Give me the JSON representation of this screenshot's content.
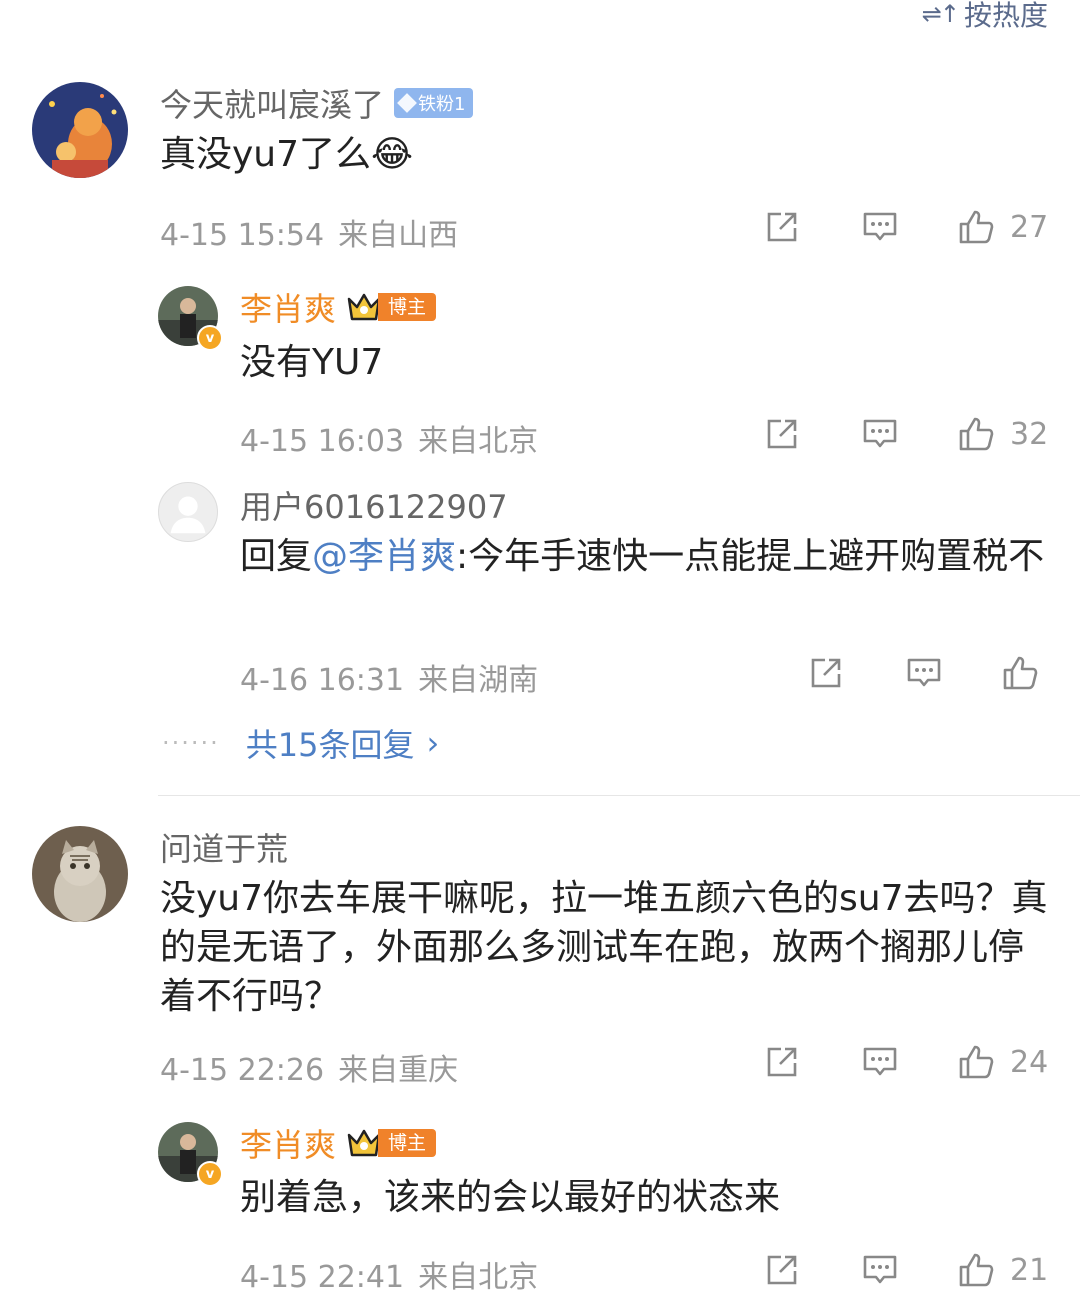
{
  "sort": {
    "icon": "sort-icon",
    "label": "按热度"
  },
  "comments": [
    {
      "user": "今天就叫宸溪了",
      "badge": "铁粉1",
      "text": "真没yu7了么",
      "emoji": "😂",
      "date": "4-15 15:54",
      "location": "来自山西",
      "likes": "27",
      "replies": [
        {
          "user": "李肖爽",
          "badge": "博主",
          "text": "没有YU7",
          "date": "4-15 16:03",
          "location": "来自北京",
          "likes": "32"
        },
        {
          "user": "用户6016122907",
          "text_prefix": "回复",
          "mention": "@李肖爽",
          "text_rest": ":今年手速快一点能提上避开购置税不",
          "date": "4-16 16:31",
          "location": "来自湖南",
          "likes": ""
        }
      ],
      "more_replies": "共15条回复"
    },
    {
      "user": "问道于荒",
      "text": "没yu7你去车展干嘛呢，拉一堆五颜六色的su7去吗？真的是无语了，外面那么多测试车在跑，放两个搁那儿停着不行吗？",
      "date": "4-15 22:26",
      "location": "来自重庆",
      "likes": "24",
      "replies": [
        {
          "user": "李肖爽",
          "badge": "博主",
          "text": "别着急，该来的会以最好的状态来",
          "date": "4-15 22:41",
          "location": "来自北京",
          "likes": "21"
        }
      ]
    }
  ],
  "colors": {
    "author": "#f08c26",
    "link": "#4e7fc4",
    "meta": "#999999",
    "fan_badge": "#8fb6ee",
    "host_badge": "#f0822a"
  }
}
